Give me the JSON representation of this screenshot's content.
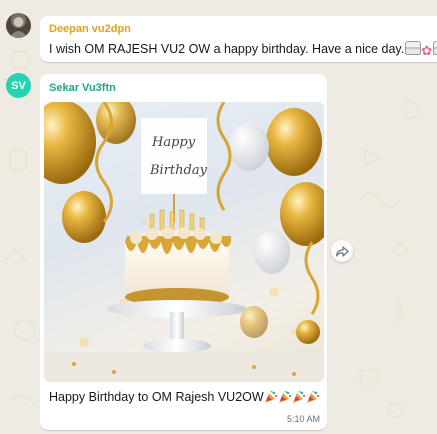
{
  "messages": [
    {
      "sender": "Deepan vu2dpn",
      "text": "I wish OM RAJESH VU2 OW   a happy birthday. Have a nice day.",
      "emojis": [
        "cake",
        "flower",
        "cake"
      ]
    },
    {
      "sender": "Sekar Vu3ftn",
      "avatar_initials": "SV",
      "image": {
        "title_line1": "Happy",
        "title_line2": "Birthday"
      },
      "caption": "Happy Birthday to OM Rajesh VU2OW",
      "caption_emojis": [
        "party-popper",
        "party-popper",
        "party-popper",
        "party-popper"
      ],
      "time": "5:10 AM"
    }
  ],
  "colors": {
    "background": "#efeae2",
    "bubble": "#ffffff",
    "sender1": "#e5a01f",
    "sender2": "#1fa88a",
    "avatar2": "#25d3b1"
  },
  "icons": [
    "user-avatar-icon",
    "forward-icon",
    "party-popper-icon",
    "birthday-cake-icon",
    "flower-icon"
  ]
}
